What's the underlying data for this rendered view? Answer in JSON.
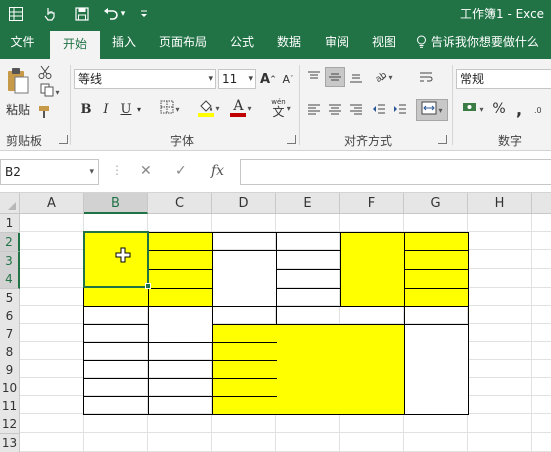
{
  "titlebar": {
    "quick_access": [
      {
        "name": "excel-app-icon",
        "glyph": "⊞"
      },
      {
        "name": "touch-mode-icon",
        "glyph": "☝"
      },
      {
        "name": "save-icon",
        "glyph": "💾"
      },
      {
        "name": "undo-icon",
        "glyph": "↶"
      },
      {
        "name": "undo-dropdown-icon",
        "glyph": "▾"
      },
      {
        "name": "customize-toolbar-icon",
        "glyph": "⁼"
      }
    ],
    "document_title": "工作簿1 - Exce"
  },
  "tabs": [
    "文件",
    "开始",
    "插入",
    "页面布局",
    "公式",
    "数据",
    "审阅",
    "视图"
  ],
  "active_tab": "开始",
  "tell_me": "告诉我你想要做什么",
  "ribbon": {
    "clipboard": {
      "paste_label": "粘贴",
      "group_label": "剪贴板"
    },
    "font": {
      "font_name": "等线",
      "font_size": "11",
      "group_label": "字体",
      "bold": "B",
      "italic": "I",
      "underline": "U",
      "grow": "A",
      "shrink": "A",
      "font_color_letter": "A",
      "phonetic": "wén",
      "highlight_color": "#ffff00",
      "font_color": "#c00000"
    },
    "alignment": {
      "group_label": "对齐方式"
    },
    "number": {
      "format": "常规",
      "group_label": "数字",
      "percent": "%",
      "comma": ","
    }
  },
  "formula_bar": {
    "name_box": "B2",
    "cancel": "✕",
    "enter": "✓",
    "fx": "fx",
    "formula": ""
  },
  "sheet": {
    "columns": [
      "A",
      "B",
      "C",
      "D",
      "E",
      "F",
      "G",
      "H"
    ],
    "rows": [
      "1",
      "2",
      "3",
      "4",
      "5",
      "6",
      "7",
      "8",
      "9",
      "10",
      "11",
      "12",
      "13"
    ],
    "selected_cell": "B2",
    "fill_color": "#ffff00",
    "selection_color": "#217346"
  }
}
